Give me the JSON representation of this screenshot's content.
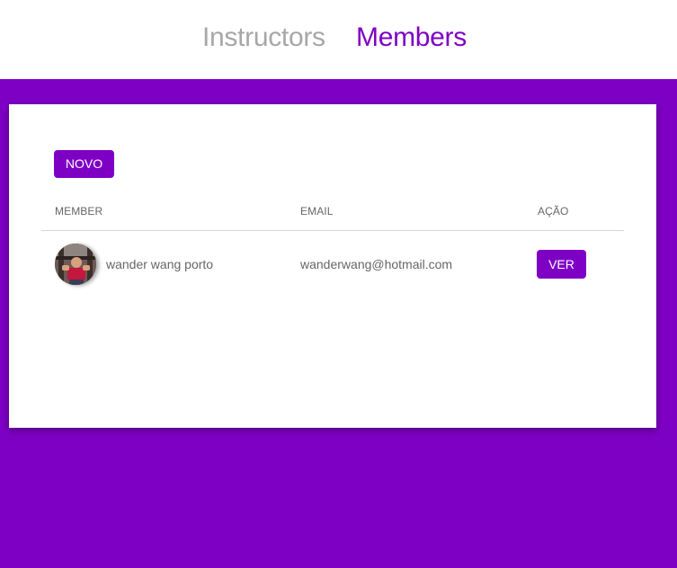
{
  "nav": {
    "instructors_label": "Instructors",
    "members_label": "Members"
  },
  "colors": {
    "brand": "#7e00c5",
    "nav_inactive": "#a7a7a7",
    "text_muted": "#666666"
  },
  "card": {
    "new_button_label": "NOVO",
    "table": {
      "headers": [
        "MEMBER",
        "EMAIL",
        "AÇÃO"
      ],
      "rows": [
        {
          "name": "wander wang porto",
          "email": "wanderwang@hotmail.com",
          "action_label": "VER",
          "avatar_icon": "user-photo"
        }
      ]
    }
  }
}
